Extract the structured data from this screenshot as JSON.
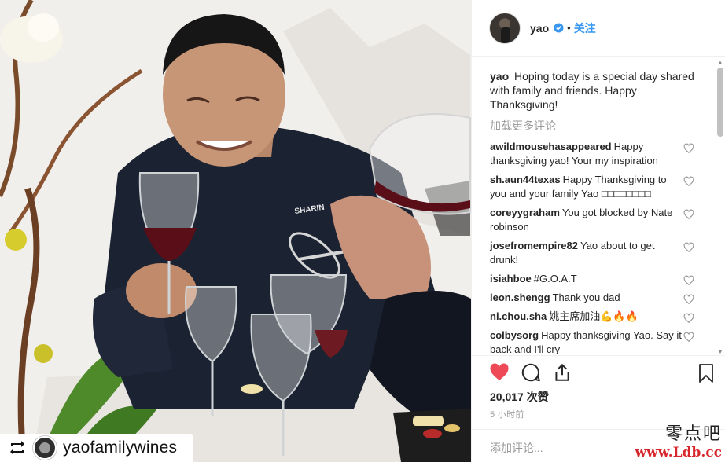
{
  "post": {
    "username": "yao",
    "follow_label": "关注",
    "separator": "•",
    "caption_user": "yao",
    "caption_text": "Hoping today is a special day shared with family and friends. Happy Thanksgiving!",
    "load_more": "加载更多评论",
    "comments": [
      {
        "user": "awildmousehasappeared",
        "text": "Happy thanksgiving yao! Your my inspiration"
      },
      {
        "user": "sh.aun44texas",
        "text": "Happy Thanksgiving to you and your family Yao □□□□□□□□"
      },
      {
        "user": "coreyygraham",
        "text": "You got blocked by Nate robinson"
      },
      {
        "user": "josefromempire82",
        "text": "Yao about to get drunk!"
      },
      {
        "user": "isiahboe",
        "text": "#G.O.A.T"
      },
      {
        "user": "leon.shengg",
        "text": "Thank you dad"
      },
      {
        "user": "ni.chou.sha",
        "text": "姚主席加油💪🔥🔥"
      },
      {
        "user": "colbysorg",
        "text": "Happy thanksgiving Yao. Say it back and I'll cry"
      }
    ],
    "likes": "20,017 次赞",
    "time_ago": "5 小时前",
    "add_comment_placeholder": "添加评论..."
  },
  "photo": {
    "repost_account": "yaofamilywines",
    "shirt_logo": "SHARIN"
  },
  "watermark": {
    "line1": "零点吧",
    "line2": "www.Ldb.cc"
  },
  "colors": {
    "accent": "#3897f0",
    "like_red": "#ed4956",
    "text": "#262626",
    "muted": "#999999"
  },
  "icons": {
    "like": "heart-icon",
    "comment": "comment-icon",
    "share": "share-icon",
    "save": "bookmark-icon",
    "verified": "verified-badge-icon",
    "repost": "repost-icon"
  }
}
